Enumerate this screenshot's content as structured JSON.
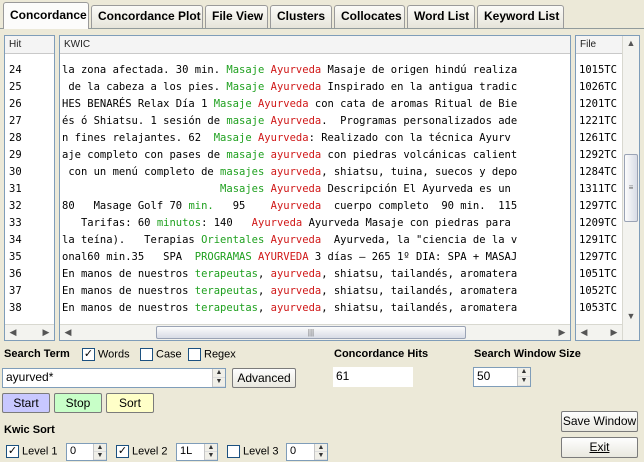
{
  "tabs": [
    {
      "label": "Concordance",
      "active": true
    },
    {
      "label": "Concordance Plot",
      "active": false
    },
    {
      "label": "File View",
      "active": false
    },
    {
      "label": "Clusters",
      "active": false
    },
    {
      "label": "Collocates",
      "active": false
    },
    {
      "label": "Word List",
      "active": false
    },
    {
      "label": "Keyword List",
      "active": false
    }
  ],
  "columns": {
    "hit": "Hit",
    "kwic": "KWIC",
    "file": "File"
  },
  "rows": [
    {
      "hit": "24",
      "segs": [
        [
          "fill",
          "la zona afectada. 30 min. "
        ],
        [
          "green",
          "Masaje "
        ],
        [
          "red",
          "Ayurveda"
        ],
        [
          "fill",
          " Masaje de origen hindú realiza"
        ]
      ],
      "file": "1015TC"
    },
    {
      "hit": "25",
      "segs": [
        [
          "fill",
          " de la cabeza a los pies. "
        ],
        [
          "green",
          "Masaje "
        ],
        [
          "red",
          "Ayurveda"
        ],
        [
          "fill",
          " Inspirado en la antigua tradic"
        ]
      ],
      "file": "1026TC"
    },
    {
      "hit": "26",
      "segs": [
        [
          "fill",
          "HES BENARÉS Relax Día 1 "
        ],
        [
          "green",
          "Masaje "
        ],
        [
          "red",
          "Ayurveda"
        ],
        [
          "fill",
          " con cata de aromas Ritual de Bie"
        ]
      ],
      "file": "1201TC"
    },
    {
      "hit": "27",
      "segs": [
        [
          "fill",
          "és ó Shiatsu. 1 sesión de "
        ],
        [
          "green",
          "masaje "
        ],
        [
          "red",
          "Ayurveda"
        ],
        [
          "fill",
          ".  Programas personalizados ade"
        ]
      ],
      "file": "1221TC"
    },
    {
      "hit": "28",
      "segs": [
        [
          "fill",
          "n fines relajantes. 62  "
        ],
        [
          "green",
          "Masaje "
        ],
        [
          "red",
          "Ayurveda"
        ],
        [
          "fill",
          ": Realizado con la técnica Ayurv"
        ]
      ],
      "file": "1261TC"
    },
    {
      "hit": "29",
      "segs": [
        [
          "fill",
          "aje completo con pases de "
        ],
        [
          "green",
          "masaje "
        ],
        [
          "red",
          "ayurveda"
        ],
        [
          "fill",
          " con piedras volcánicas calient"
        ]
      ],
      "file": "1292TC"
    },
    {
      "hit": "30",
      "segs": [
        [
          "fill",
          " con un menú completo de "
        ],
        [
          "green",
          "masajes "
        ],
        [
          "red",
          "ayurveda"
        ],
        [
          "fill",
          ", shiatsu, tuina, suecos y depo"
        ]
      ],
      "file": "1284TC"
    },
    {
      "hit": "31",
      "segs": [
        [
          "fill",
          "                         "
        ],
        [
          "green",
          "Masajes "
        ],
        [
          "red",
          "Ayurveda"
        ],
        [
          "fill",
          " Descripción El Ayurveda es un"
        ]
      ],
      "file": "1311TC"
    },
    {
      "hit": "32",
      "segs": [
        [
          "fill",
          "80   Masage Golf 70 "
        ],
        [
          "green",
          "min."
        ],
        [
          "fill",
          "   95    "
        ],
        [
          "red",
          "Ayurveda"
        ],
        [
          "fill",
          "  cuerpo completo  90 min.  115"
        ]
      ],
      "file": "1297TC"
    },
    {
      "hit": "33",
      "segs": [
        [
          "fill",
          "   Tarifas: 60 "
        ],
        [
          "green",
          "minutos"
        ],
        [
          "fill",
          ": 140   "
        ],
        [
          "red",
          "Ayurveda"
        ],
        [
          "fill",
          " Ayurveda Masaje con piedras para"
        ]
      ],
      "file": "1209TC"
    },
    {
      "hit": "34",
      "segs": [
        [
          "fill",
          "la teína).   Terapias "
        ],
        [
          "green",
          "Orientales "
        ],
        [
          "red",
          "Ayurveda"
        ],
        [
          "fill",
          "  Ayurveda, la \"ciencia de la v"
        ]
      ],
      "file": "1291TC"
    },
    {
      "hit": "35",
      "segs": [
        [
          "fill",
          "onal60 min.35   SPA  "
        ],
        [
          "green",
          "PROGRAMAS "
        ],
        [
          "red",
          "AYURVEDA"
        ],
        [
          "fill",
          " 3 días – 265 1º DIA: SPA + MASAJ"
        ]
      ],
      "file": "1297TC"
    },
    {
      "hit": "36",
      "segs": [
        [
          "fill",
          "En manos de nuestros "
        ],
        [
          "green",
          "terapeutas"
        ],
        [
          "fill",
          ", "
        ],
        [
          "red",
          "ayurveda"
        ],
        [
          "fill",
          ", shiatsu, tailandés, aromatera"
        ]
      ],
      "file": "1051TC"
    },
    {
      "hit": "37",
      "segs": [
        [
          "fill",
          "En manos de nuestros "
        ],
        [
          "green",
          "terapeutas"
        ],
        [
          "fill",
          ", "
        ],
        [
          "red",
          "ayurveda"
        ],
        [
          "fill",
          ", shiatsu, tailandés, aromatera"
        ]
      ],
      "file": "1052TC"
    },
    {
      "hit": "38",
      "segs": [
        [
          "fill",
          "En manos de nuestros "
        ],
        [
          "green",
          "terapeutas"
        ],
        [
          "fill",
          ", "
        ],
        [
          "red",
          "ayurveda"
        ],
        [
          "fill",
          ", shiatsu, tailandés, aromatera"
        ]
      ],
      "file": "1053TC"
    }
  ],
  "search": {
    "label": "Search Term",
    "words_label": "Words",
    "words_checked": true,
    "case_label": "Case",
    "case_checked": false,
    "regex_label": "Regex",
    "regex_checked": false,
    "value": "ayurved*",
    "advanced_label": "Advanced"
  },
  "hits": {
    "label": "Concordance Hits",
    "value": "61"
  },
  "window": {
    "label": "Search Window Size",
    "value": "50"
  },
  "buttons": {
    "start": "Start",
    "stop": "Stop",
    "sort": "Sort",
    "save": "Save Window",
    "exit": "Exit"
  },
  "kwic_sort": {
    "label": "Kwic Sort",
    "level1_label": "Level 1",
    "level1_checked": true,
    "level1_value": "0",
    "level2_label": "Level 2",
    "level2_checked": true,
    "level2_value": "1L",
    "level3_label": "Level 3",
    "level3_checked": false,
    "level3_value": "0"
  },
  "colors": {
    "keyword": "#d01818",
    "collocate": "#1fa01f",
    "start": "#c8c8ff",
    "stop": "#c8ffc8",
    "sort": "#ffffc8"
  }
}
